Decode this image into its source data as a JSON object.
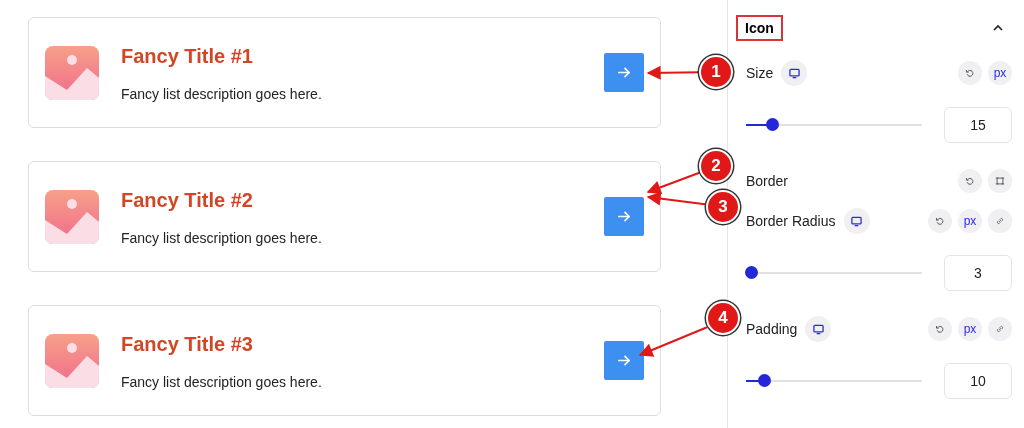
{
  "cards": [
    {
      "title": "Fancy Title #1",
      "description": "Fancy list description goes here."
    },
    {
      "title": "Fancy Title #2",
      "description": "Fancy list description goes here."
    },
    {
      "title": "Fancy Title #3",
      "description": "Fancy list description goes here."
    }
  ],
  "panel": {
    "title": "Icon",
    "title_highlighted": true,
    "expanded": true,
    "controls": [
      {
        "kind": "label",
        "label": "Size",
        "responsive": true,
        "actions": [
          {
            "kind": "reset"
          },
          {
            "kind": "unit",
            "text": "px"
          }
        ]
      },
      {
        "kind": "slider",
        "level": 0.15,
        "value": "15"
      },
      {
        "kind": "label",
        "label": "Border",
        "actions": [
          {
            "kind": "reset"
          },
          {
            "kind": "border"
          }
        ]
      },
      {
        "kind": "label",
        "label": "Border Radius",
        "responsive": true,
        "actions": [
          {
            "kind": "reset"
          },
          {
            "kind": "unit",
            "text": "px"
          },
          {
            "kind": "link"
          }
        ]
      },
      {
        "kind": "slider",
        "level": 0.03,
        "value": "3"
      },
      {
        "kind": "label",
        "label": "Padding",
        "responsive": true,
        "actions": [
          {
            "kind": "reset"
          },
          {
            "kind": "unit",
            "text": "px"
          },
          {
            "kind": "link"
          }
        ]
      },
      {
        "kind": "slider",
        "level": 0.1,
        "value": "10"
      }
    ]
  },
  "annotations": [
    {
      "number": "1"
    },
    {
      "number": "2"
    },
    {
      "number": "3"
    },
    {
      "number": "4"
    }
  ]
}
